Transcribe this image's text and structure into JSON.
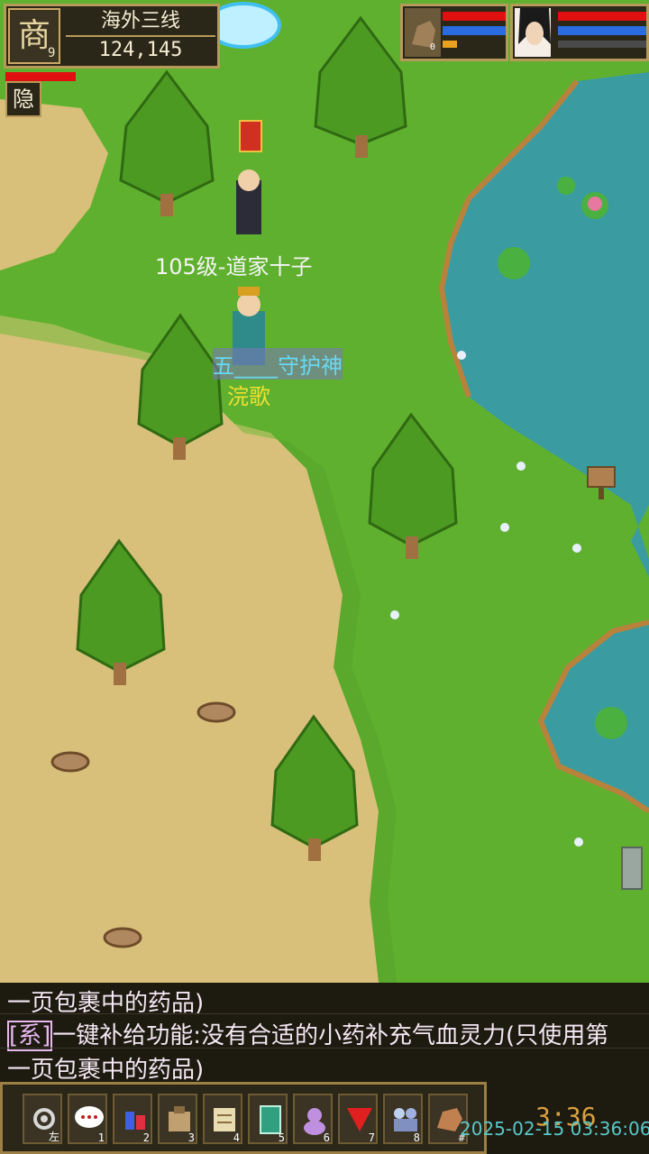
{
  "hud": {
    "map_emblem": "商",
    "map_level": "9",
    "map_name": "海外三线",
    "coords": "124,145",
    "hide_label": "隐",
    "party_level": "0"
  },
  "characters": {
    "pet_name": "105级-道家十子",
    "title": "五____守护神",
    "player_name": "浣歌"
  },
  "chat": {
    "line1": "一页包裹中的药品)",
    "line2_tag": "[系]",
    "line2": "一键补给功能:没有合适的小药补充气血灵力(只使用第",
    "line3": "一页包裹中的药品)"
  },
  "skillbar": {
    "slots": [
      {
        "icon": "gear-icon",
        "key": "左"
      },
      {
        "icon": "chat-icon",
        "key": "1"
      },
      {
        "icon": "potion-icon",
        "key": "2"
      },
      {
        "icon": "bag-icon",
        "key": "3"
      },
      {
        "icon": "scroll-icon",
        "key": "4"
      },
      {
        "icon": "book-icon",
        "key": "5"
      },
      {
        "icon": "pet-icon",
        "key": "6"
      },
      {
        "icon": "flag-icon",
        "key": "7"
      },
      {
        "icon": "team-icon",
        "key": "8"
      },
      {
        "icon": "horse-icon",
        "key": "#"
      }
    ]
  },
  "clock": "3:36",
  "timestamp": "2025-02-15 03:36:06",
  "colors": {
    "grass": "#5aa82c",
    "sand": "#d8c078",
    "water": "#3a9ca0",
    "hp": "#e01010",
    "mp": "#2a6ce0"
  }
}
